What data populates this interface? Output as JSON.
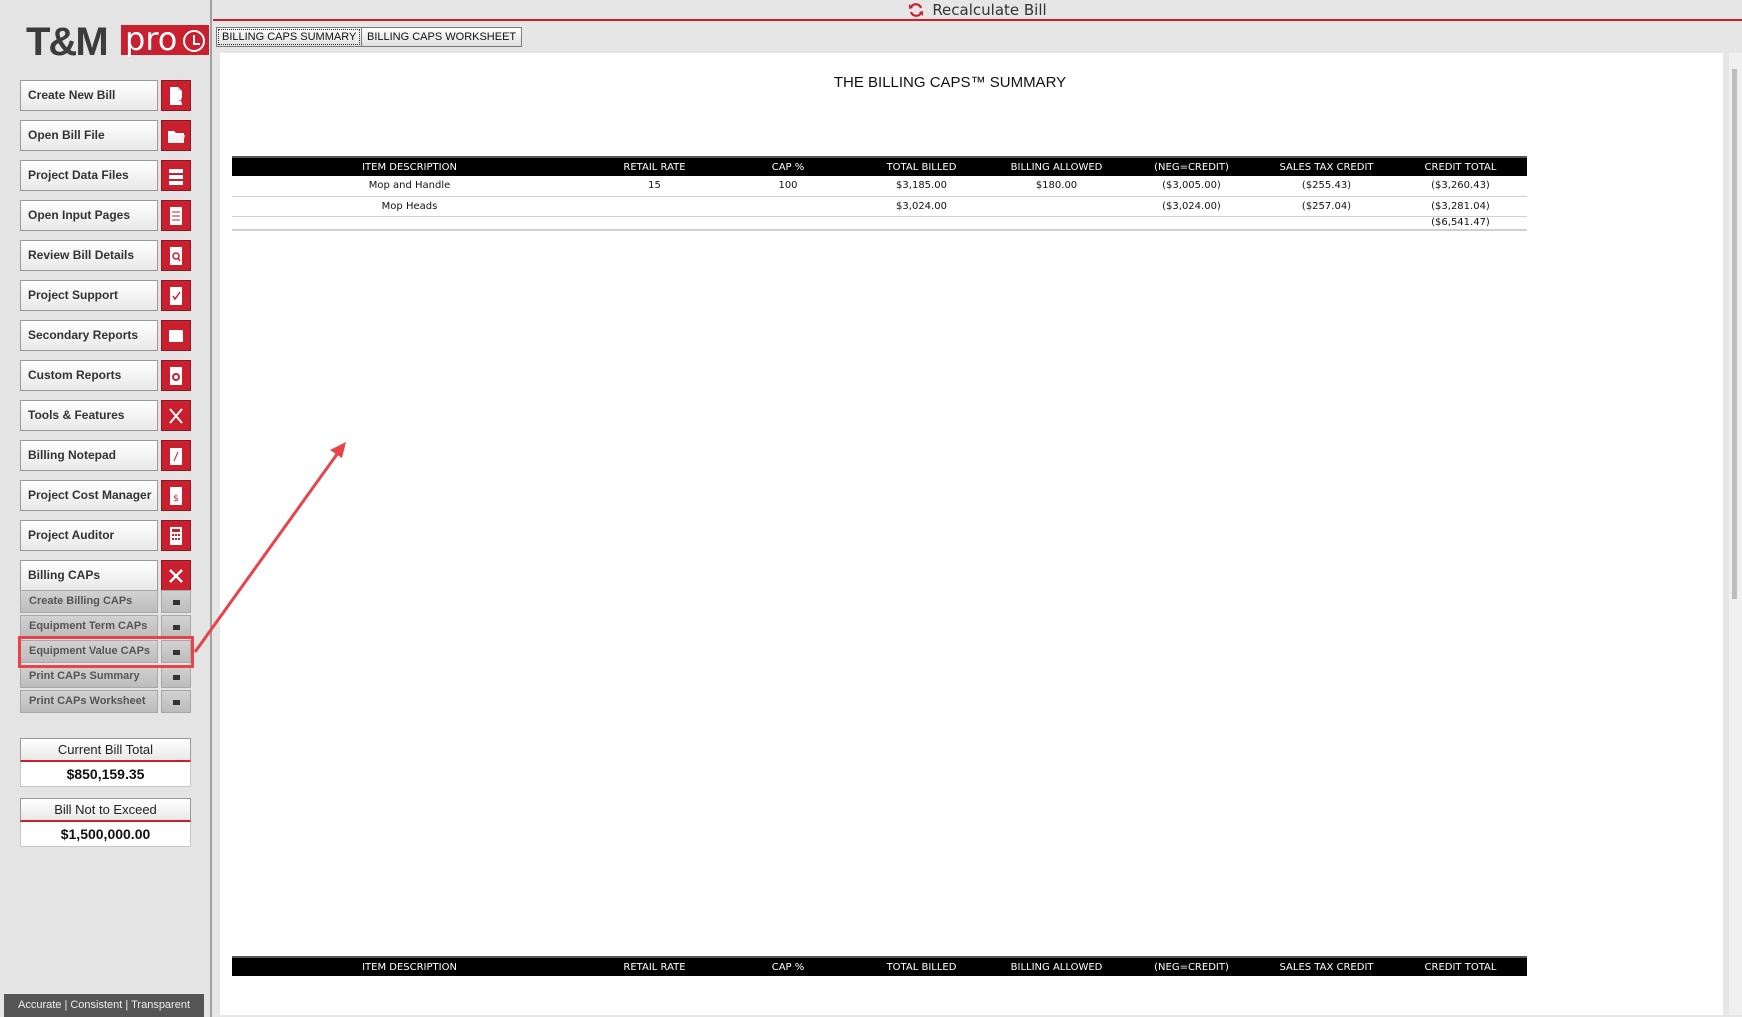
{
  "sidebar": {
    "logo": {
      "main": "T&M",
      "accent": "pro"
    },
    "nav": [
      {
        "label": "Create New Bill",
        "icon": "new-file-icon"
      },
      {
        "label": "Open Bill File",
        "icon": "folder-open-icon"
      },
      {
        "label": "Project Data Files",
        "icon": "list-icon"
      },
      {
        "label": "Open Input Pages",
        "icon": "form-icon"
      },
      {
        "label": "Review Bill Details",
        "icon": "magnify-document-icon"
      },
      {
        "label": "Project Support",
        "icon": "checklist-icon"
      },
      {
        "label": "Secondary Reports",
        "icon": "report-icon"
      },
      {
        "label": "Custom Reports",
        "icon": "gear-document-icon"
      },
      {
        "label": "Tools & Features",
        "icon": "tools-icon"
      },
      {
        "label": "Billing Notepad",
        "icon": "notepad-icon"
      },
      {
        "label": "Project Cost Manager",
        "icon": "dollar-document-icon"
      },
      {
        "label": "Project Auditor",
        "icon": "calculator-icon"
      },
      {
        "label": "Billing CAPs",
        "icon": "close-icon"
      }
    ],
    "caps_subitems": [
      {
        "label": "Create Billing CAPs"
      },
      {
        "label": "Equipment Term CAPs"
      },
      {
        "label": "Equipment Value CAPs"
      },
      {
        "label": "Print CAPs Summary"
      },
      {
        "label": "Print CAPs Worksheet"
      }
    ],
    "current_bill_total": {
      "label": "Current Bill Total",
      "value": "$850,159.35"
    },
    "bill_not_to_exceed": {
      "label": "Bill Not to Exceed",
      "value": "$1,500,000.00"
    },
    "tagline": "Accurate | Consistent | Transparent"
  },
  "topbar": {
    "recalculate_label": "Recalculate Bill",
    "icon": "refresh-icon"
  },
  "tabs": [
    {
      "label": "BILLING CAPS SUMMARY",
      "active": true
    },
    {
      "label": "BILLING CAPS WORKSHEET",
      "active": false
    }
  ],
  "report": {
    "title": "THE BILLING CAPS™ SUMMARY",
    "columns": [
      "ITEM DESCRIPTION",
      "RETAIL RATE",
      "CAP %",
      "TOTAL BILLED",
      "BILLING ALLOWED",
      "(NEG=CREDIT)",
      "SALES TAX CREDIT",
      "CREDIT TOTAL"
    ],
    "rows": [
      [
        "Mop and Handle",
        "15",
        "100",
        "$3,185.00",
        "$180.00",
        "($3,005.00)",
        "($255.43)",
        "($3,260.43)"
      ],
      [
        "Mop Heads",
        "",
        "",
        "$3,024.00",
        "",
        "($3,024.00)",
        "($257.04)",
        "($3,281.04)"
      ],
      [
        "",
        "",
        "",
        "",
        "",
        "",
        "",
        "($6,541.47)"
      ]
    ]
  },
  "colors": {
    "brand_red": "#c8202f",
    "annotation_red": "#e8424b"
  }
}
